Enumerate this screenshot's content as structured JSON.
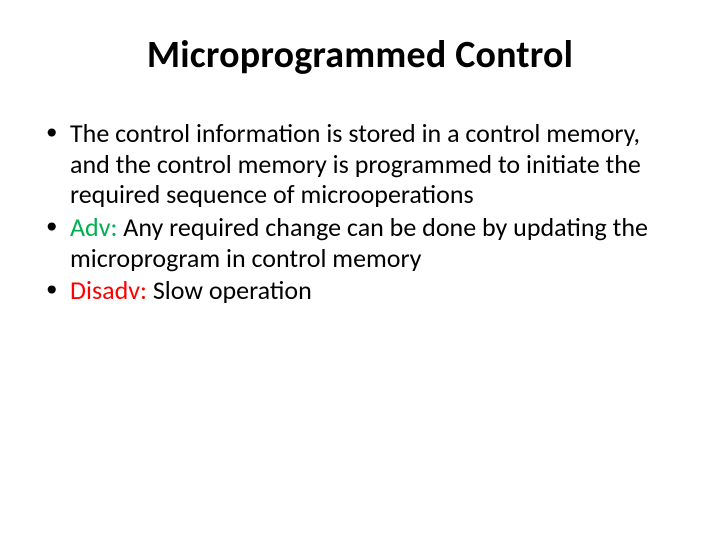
{
  "title": "Microprogrammed Control",
  "bullets": {
    "b1": "The control information is stored in a control memory, and the control memory is programmed to initiate the required sequence of microoperations",
    "b2_label": "Adv: ",
    "b2_text": "Any required change can be done by updating the microprogram in control memory",
    "b3_label": "Disadv: ",
    "b3_text": "Slow operation"
  }
}
